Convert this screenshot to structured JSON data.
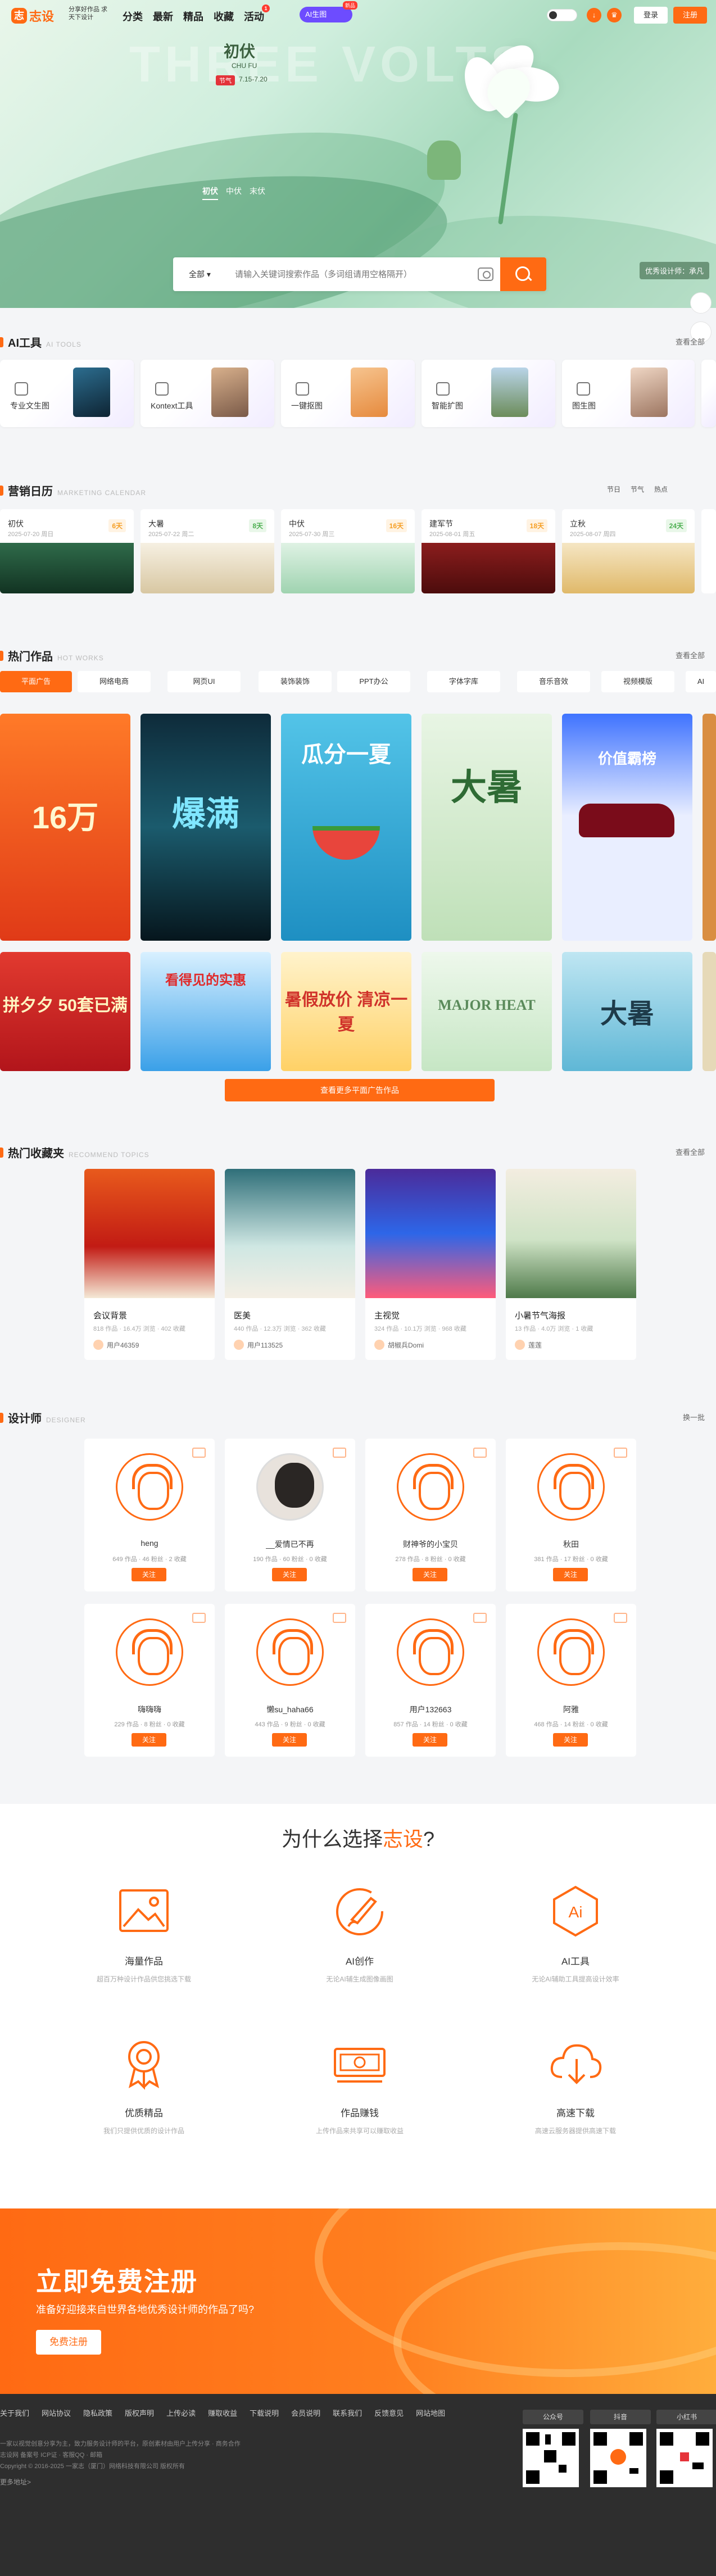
{
  "nav": {
    "logo": "志设",
    "logo_mark": "志",
    "slogan": "分享好作品 求天下设计",
    "links": [
      "分类",
      "最新",
      "精品",
      "收藏",
      "活动"
    ],
    "activity_badge": "1",
    "ai_label": "AI生图",
    "ai_new": "新品",
    "login": "登录",
    "register": "注册"
  },
  "hero": {
    "bg_text": "THREE VOLTS",
    "title": "初伏",
    "subtitle": "CHU FU",
    "tag": "节气",
    "date": "7.15-7.20",
    "tabs": [
      "初伏",
      "中伏",
      "末伏"
    ],
    "designer_chip": "优秀设计师：承凡"
  },
  "search": {
    "scope": "全部",
    "placeholder": "请输入关键词搜索作品（多词组请用空格隔开）"
  },
  "ai_tools": {
    "title": "AI工具",
    "en": "AI TOOLS",
    "more": "查看全部",
    "items": [
      "专业文生图",
      "Kontext工具",
      "一键抠图",
      "智能扩图",
      "图生图"
    ]
  },
  "calendar": {
    "title": "营销日历",
    "en": "MARKETING CALENDAR",
    "filters": [
      "节日",
      "节气",
      "热点"
    ],
    "items": [
      {
        "name": "初伏",
        "date": "2025-07-20 周日",
        "count": "6天",
        "color": "#f59e23"
      },
      {
        "name": "大暑",
        "date": "2025-07-22 周二",
        "count": "8天",
        "color": "#4caf50"
      },
      {
        "name": "中伏",
        "date": "2025-07-30 周三",
        "count": "16天",
        "color": "#f59e23"
      },
      {
        "name": "建军节",
        "date": "2025-08-01 周五",
        "count": "18天",
        "color": "#f59e23"
      },
      {
        "name": "立秋",
        "date": "2025-08-07 周四",
        "count": "24天",
        "color": "#4caf50"
      }
    ]
  },
  "works": {
    "title": "热门作品",
    "en": "HOT WORKS",
    "more": "查看全部",
    "tabs": [
      "平面广告",
      "网络电商",
      "网页UI",
      "装饰装饰",
      "PPT办公",
      "字体字库",
      "音乐音效",
      "视频模版",
      "AI"
    ],
    "posters_row1": [
      "16万",
      "爆满",
      "瓜分一夏",
      "大暑",
      "价值霸榜"
    ],
    "posters_row2": [
      "拼夕夕 50套已满",
      "看得见的实惠",
      "暑假放价 清凉一夏",
      "MAJOR HEAT",
      "大暑"
    ],
    "more_button": "查看更多平面广告作品"
  },
  "topics": {
    "title": "热门收藏夹",
    "en": "RECOMMEND TOPICS",
    "more": "查看全部",
    "items": [
      {
        "name": "会议背景",
        "stats": "818 作品 · 16.4万 浏览 · 402 收藏",
        "user": "用户46359"
      },
      {
        "name": "医美",
        "stats": "440 作品 · 12.3万 浏览 · 362 收藏",
        "user": "用户113525"
      },
      {
        "name": "主视觉",
        "stats": "324 作品 · 10.1万 浏览 · 968 收藏",
        "user": "胡椒兵Domi"
      },
      {
        "name": "小暑节气海报",
        "stats": "13 作品 · 4.0万 浏览 · 1 收藏",
        "user": "莲莲"
      }
    ]
  },
  "designers": {
    "title": "设计师",
    "en": "DESIGNER",
    "more": "换一批",
    "follow": "关注",
    "items": [
      {
        "name": "heng",
        "stats": "649 作品 · 46 粉丝 · 2 收藏"
      },
      {
        "name": "__爱情已不再",
        "stats": "190 作品 · 60 粉丝 · 0 收藏"
      },
      {
        "name": "财神爷的小宝贝",
        "stats": "278 作品 · 8 粉丝 · 0 收藏"
      },
      {
        "name": "秋田",
        "stats": "381 作品 · 17 粉丝 · 0 收藏"
      },
      {
        "name": "嗨嗨嗨",
        "stats": "229 作品 · 8 粉丝 · 0 收藏"
      },
      {
        "name": "懒su_haha66",
        "stats": "443 作品 · 9 粉丝 · 0 收藏"
      },
      {
        "name": "用户132663",
        "stats": "857 作品 · 14 粉丝 · 0 收藏"
      },
      {
        "name": "阿雅",
        "stats": "468 作品 · 14 粉丝 · 0 收藏"
      }
    ]
  },
  "why": {
    "title_pre": "为什么选择",
    "title_brand": "志设",
    "title_post": "?",
    "features": [
      {
        "name": "海量作品",
        "desc": "超百万种设计作品供您挑选下载",
        "icon": "image-icon"
      },
      {
        "name": "AI创作",
        "desc": "无论AI辅生成图像画图",
        "icon": "brush-icon"
      },
      {
        "name": "AI工具",
        "desc": "无论AI辅助工具提高设计效率",
        "icon": "ai-icon"
      },
      {
        "name": "优质精品",
        "desc": "我们只提供优质的设计作品",
        "icon": "award-icon"
      },
      {
        "name": "作品赚钱",
        "desc": "上传作品来共享可以赚取收益",
        "icon": "money-icon"
      },
      {
        "name": "高速下载",
        "desc": "高速云服务器提供高速下载",
        "icon": "cloud-download-icon"
      }
    ]
  },
  "register": {
    "title": "立即免费注册",
    "subtitle": "准备好迎接来自世界各地优秀设计师的作品了吗?",
    "button": "免费注册"
  },
  "footer": {
    "links": [
      "关于我们",
      "网站协议",
      "隐私政策",
      "版权声明",
      "上传必读",
      "赚取收益",
      "下载说明",
      "会员说明",
      "联系我们",
      "反馈意见",
      "网站地图"
    ],
    "lines": [
      "一家以视觉创意分享为主，致力服务设计师的平台，原创素材由用户上传分享 · 商务合作",
      "志设网 备案号 ICP证 · 客服QQ · 邮箱",
      "Copyright © 2016-2025 一家志（厦门）网络科技有限公司 版权所有"
    ],
    "qr_labels": [
      "公众号",
      "抖音",
      "小红书"
    ],
    "bottom": "更多地址>"
  },
  "colors": {
    "accent": "#ff6a13",
    "ai": "#6d4cff"
  }
}
